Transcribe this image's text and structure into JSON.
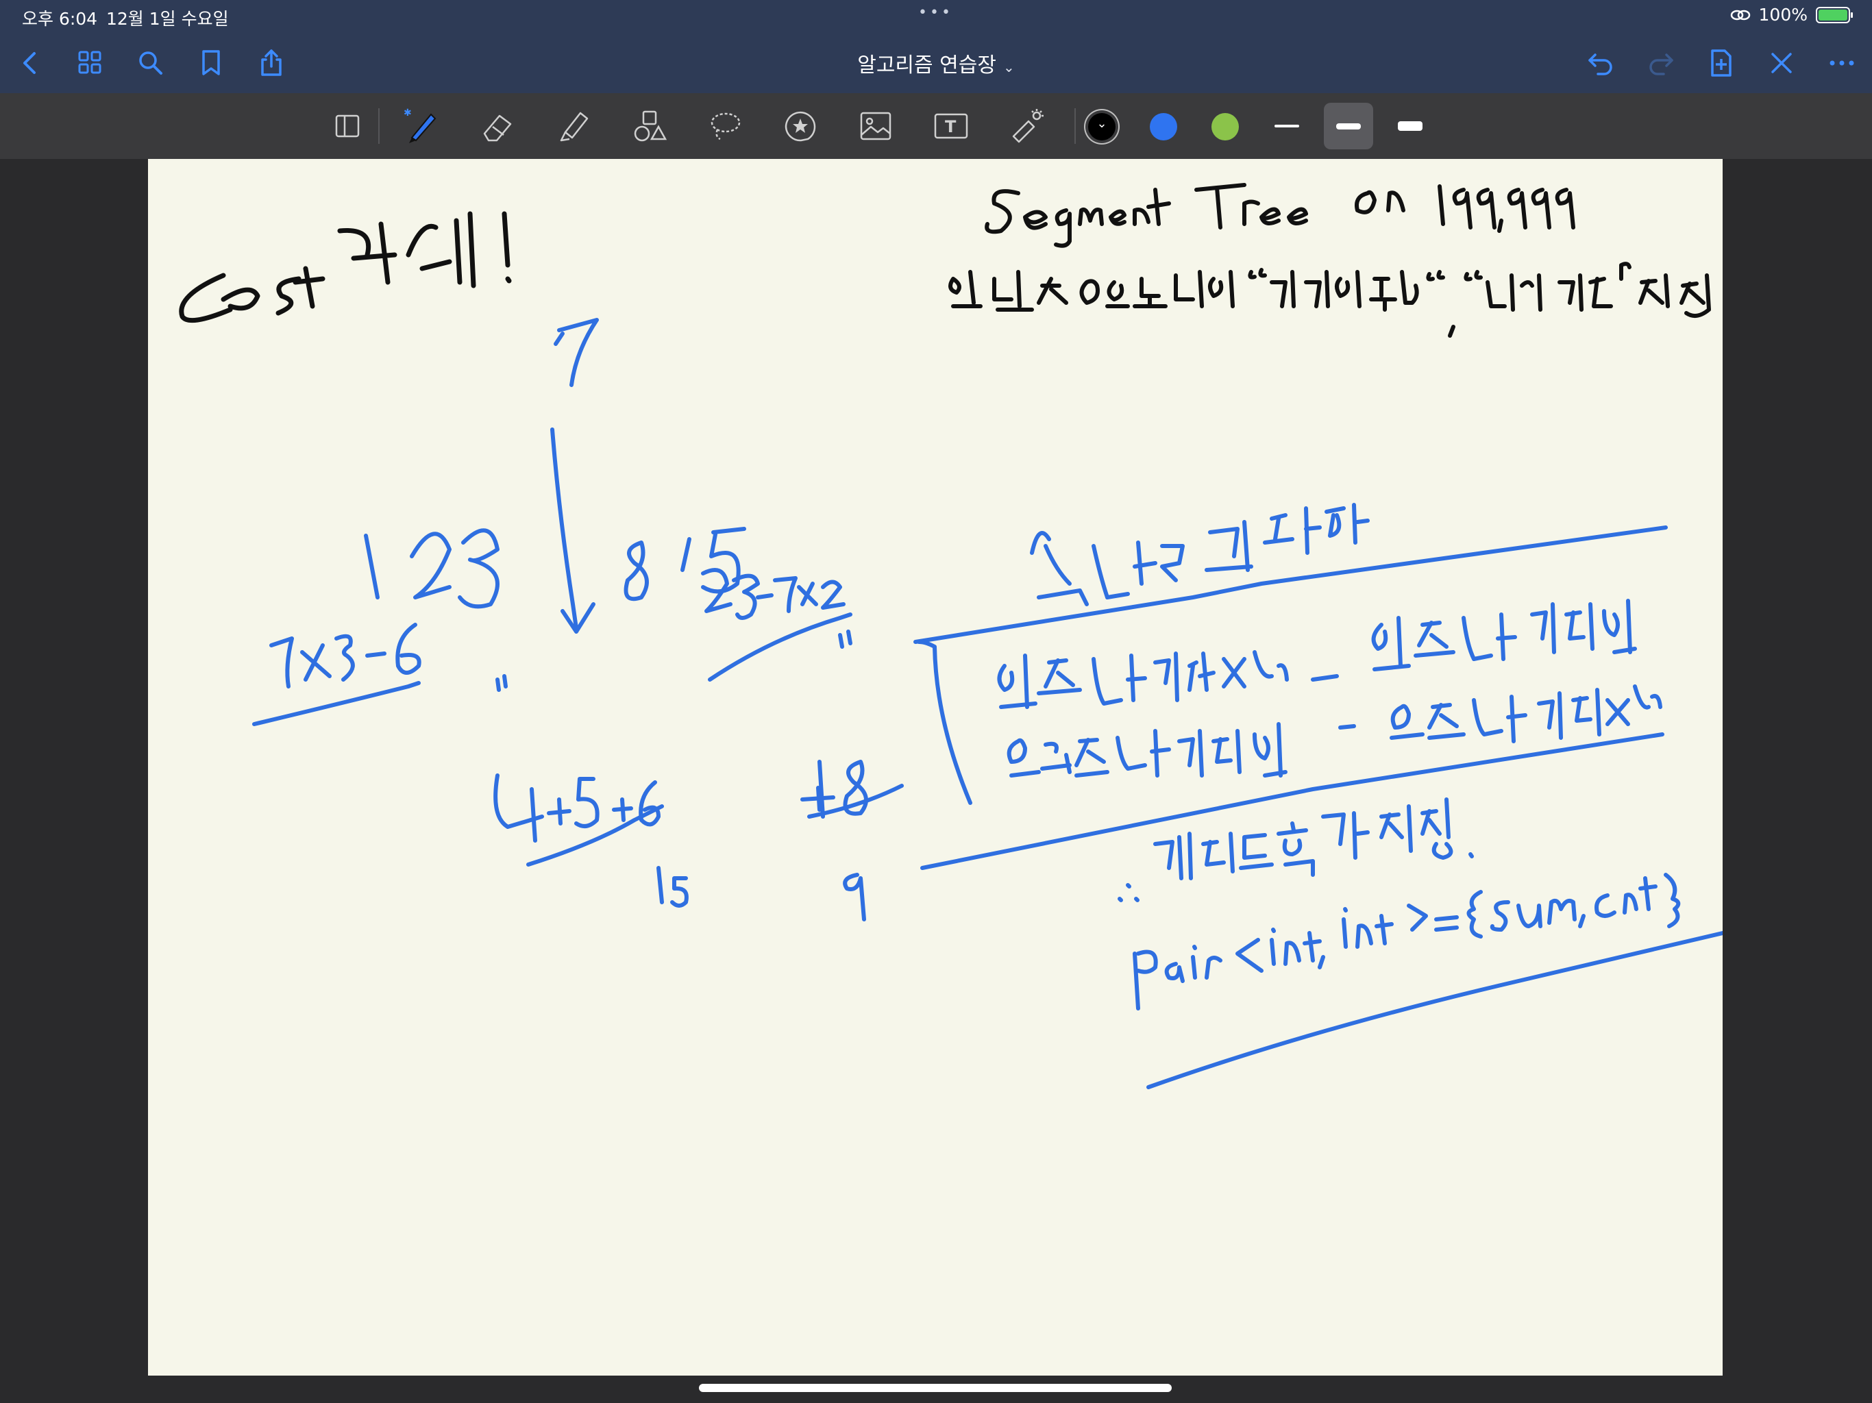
{
  "status": {
    "time": "오후 6:04",
    "date": "12월 1일 수요일",
    "battery_text": "100%"
  },
  "nav": {
    "title": "알고리즘 연습장",
    "icons": [
      "back-icon",
      "grid-icon",
      "search-icon",
      "bookmark-icon",
      "share-icon",
      "undo-icon",
      "redo-icon",
      "add-page-icon",
      "close-icon",
      "more-icon"
    ]
  },
  "toolbar": {
    "tools": [
      "read-mode-icon",
      "pen-icon",
      "eraser-icon",
      "highlighter-icon",
      "shapes-icon",
      "lasso-icon",
      "sticker-icon",
      "image-icon",
      "text-icon",
      "laser-pointer-icon"
    ],
    "colors": {
      "black": "#000000",
      "blue": "#2f74f0",
      "green": "#8bc34a"
    },
    "active_tool": "pen"
  },
  "colors": {
    "bar_bg": "#2e3b56",
    "toolbar_bg": "#3a3a3c",
    "paper": "#f6f6ea",
    "ink_black": "#111111",
    "ink_blue": "#2f6fe0"
  }
}
